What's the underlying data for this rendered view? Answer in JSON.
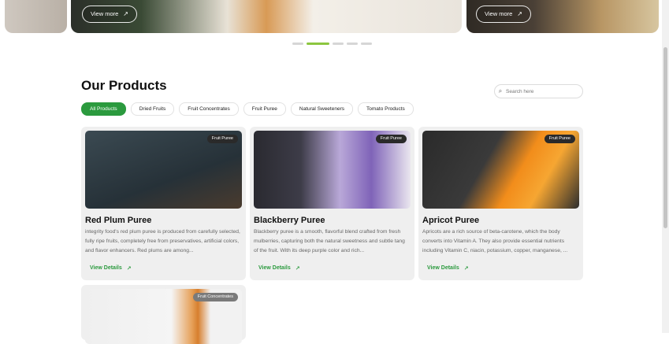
{
  "carousel": {
    "slides": [
      {
        "button_label": "View more"
      },
      {
        "button_label": "View more"
      }
    ]
  },
  "section": {
    "title": "Our Products",
    "search_placeholder": "Search here"
  },
  "filters": [
    {
      "label": "All Products",
      "active": true
    },
    {
      "label": "Dried Fruits",
      "active": false
    },
    {
      "label": "Fruit Concentrates",
      "active": false
    },
    {
      "label": "Fruit Puree",
      "active": false
    },
    {
      "label": "Natural Sweeteners",
      "active": false
    },
    {
      "label": "Tomato Products",
      "active": false
    }
  ],
  "products": [
    {
      "tag": "Fruit Puree",
      "name": "Red Plum Puree",
      "description": "integrity food's red plum puree is produced from carefully selected, fully ripe fruits, completely free from preservatives, artificial colors, and flavor enhancers. Red plums are among...",
      "link": "View Details"
    },
    {
      "tag": "Fruit Puree",
      "name": "Blackberry Puree",
      "description": "Blackberry puree is a smooth, flavorful blend crafted from fresh mulberries, capturing both the natural sweetness and subtle tang of the fruit. With its deep purple color and rich...",
      "link": "View Details"
    },
    {
      "tag": "Fruit Puree",
      "name": "Apricot Puree",
      "description": "Apricots are a rich source of beta-carotene, which the body converts into Vitamin A. They also provide essential nutrients including Vitamin C, niacin, potassium, copper, manganese, ...",
      "link": "View Details"
    },
    {
      "tag": "Fruit Concentrates"
    }
  ],
  "colors": {
    "accent": "#2b9a3e",
    "dot_active": "#8cc63f"
  },
  "icons": {
    "search": "search-icon",
    "arrow": "arrow-up-right-icon"
  }
}
